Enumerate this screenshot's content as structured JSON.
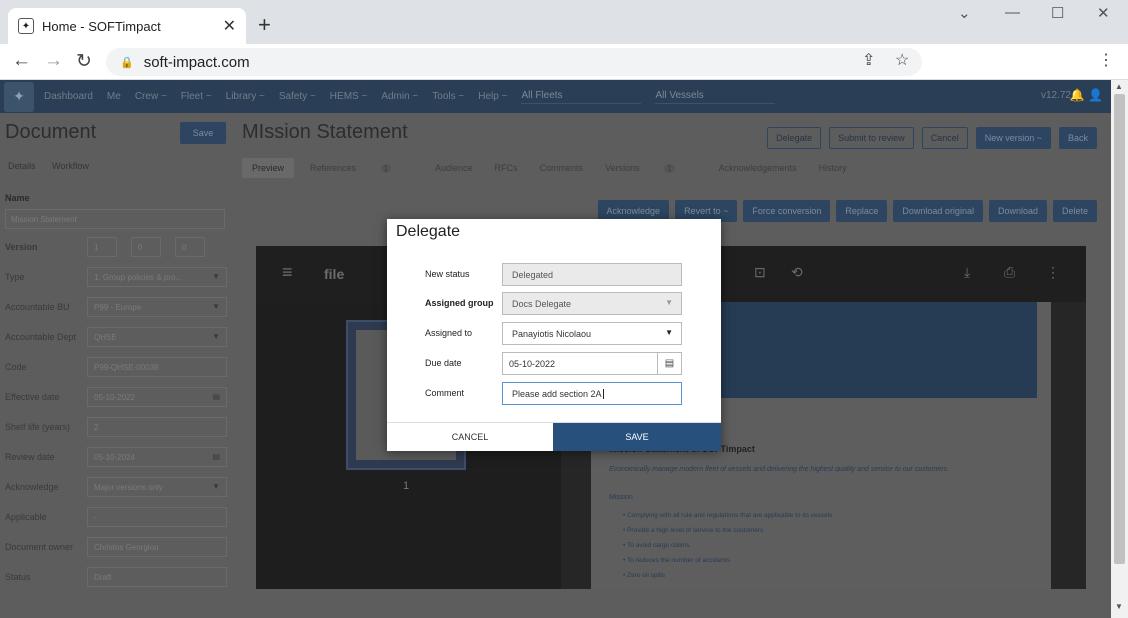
{
  "browser": {
    "tab_title": "Home - SOFTimpact",
    "url": "soft-impact.com"
  },
  "appnav": {
    "items": [
      "Dashboard",
      "Me",
      "Crew ~",
      "Fleet ~",
      "Library ~",
      "Safety ~",
      "HEMS ~",
      "Admin ~",
      "Tools ~",
      "Help ~"
    ],
    "fleet_select": "All Fleets",
    "vessel_select": "All Vessels",
    "version": "v12.72"
  },
  "left": {
    "title": "Document",
    "save": "Save",
    "tabs": [
      "Details",
      "Workflow"
    ],
    "name_label": "Name",
    "name_value": "Mission Statement",
    "version_label": "Version",
    "version_values": [
      "1",
      "0",
      "0"
    ],
    "fields": [
      {
        "label": "Type",
        "value": "1. Group policies & pro...",
        "kind": "select"
      },
      {
        "label": "Accountable BU",
        "value": "P99 - Europe",
        "kind": "select"
      },
      {
        "label": "Accountable Dept",
        "value": "QHSE",
        "kind": "select"
      },
      {
        "label": "Code",
        "value": "P99-QHSE-00038",
        "kind": "text"
      },
      {
        "label": "Effective date",
        "value": "05-10-2022",
        "kind": "date"
      },
      {
        "label": "Shelf life (years)",
        "value": "2",
        "kind": "text"
      },
      {
        "label": "Review date",
        "value": "05-10-2024",
        "kind": "date"
      },
      {
        "label": "Acknowledge",
        "value": "Major versions only",
        "kind": "select"
      },
      {
        "label": "Applicable",
        "value": "-",
        "kind": "text"
      },
      {
        "label": "Document owner",
        "value": "Christos Georgiou",
        "kind": "text"
      },
      {
        "label": "Status",
        "value": "Draft",
        "kind": "text"
      }
    ]
  },
  "main": {
    "title": "MIssion Statement",
    "header_buttons": [
      "Delegate",
      "Submit to review",
      "Cancel",
      "New version ~",
      "Back"
    ],
    "tabs": [
      "Preview",
      "References",
      "Audience",
      "RFCs",
      "Comments",
      "Versions",
      "Acknowledgements",
      "History"
    ],
    "references_count": "1",
    "versions_count": "1",
    "action_buttons": [
      "Acknowledge",
      "Revert to ~",
      "Force conversion",
      "Replace",
      "Download original",
      "Download",
      "Delete"
    ],
    "viewer_file": "file",
    "page_number": "1",
    "doc_heading": "Mission Statement of SOFTimpact",
    "doc_subtitle": "Economically manage modern fleet of vessels and delivering the highest quality and service to our customers.",
    "doc_mission": "Mission",
    "doc_list": [
      "Complying with all rule and regulations that are applicable to its vessels",
      "Provide a high level of service to the customers",
      "To avoid cargo claims",
      "To reduces the number of accidents",
      "Zero oil spills"
    ]
  },
  "dialog": {
    "title": "Delegate",
    "new_status_label": "New status",
    "new_status_value": "Delegated",
    "assigned_group_label": "Assigned group",
    "assigned_group_value": "Docs Delegate",
    "assigned_to_label": "Assigned to",
    "assigned_to_value": "Panayiotis Nicolaou",
    "due_date_label": "Due date",
    "due_date_value": "05-10-2022",
    "comment_label": "Comment",
    "comment_value": "Please add section 2A",
    "cancel": "CANCEL",
    "save": "SAVE"
  }
}
